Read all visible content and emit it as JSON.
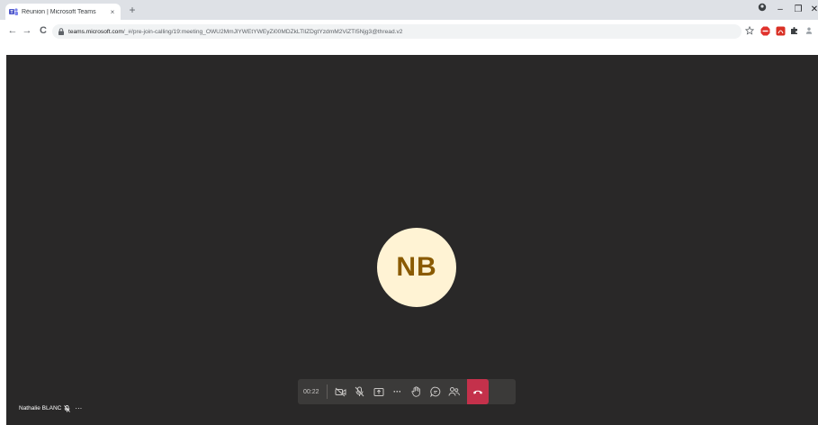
{
  "browser": {
    "tab_title": "Réunion | Microsoft Teams",
    "tab_close": "×",
    "new_tab": "+",
    "url_host": "teams.microsoft.com",
    "url_path": "/_#/pre-join-calling/19:meeting_OWU2MmJlYWEtYWEyZi00MDZkLTllZDgtYzdmM2ViZTI5Njg3@thread.v2",
    "back_glyph": "←",
    "forward_glyph": "→",
    "reload_glyph": "C",
    "minimize_glyph": "–",
    "restore_glyph": "❐",
    "close_glyph": "✕"
  },
  "meeting": {
    "avatar_initials": "NB",
    "timer": "00:22",
    "participant_name": "Nathalie BLANC",
    "participant_more": "···",
    "more_actions": "···",
    "colors": {
      "stage_background": "#292828",
      "control_bar": "#3b3a39",
      "hangup": "#c4314b",
      "avatar_background": "#fff3d4",
      "avatar_text": "#8a5a00"
    },
    "icons": [
      "camera-off-icon",
      "mic-off-icon",
      "share-screen-icon",
      "more-icon",
      "raise-hand-icon",
      "chat-icon",
      "participants-icon",
      "hang-up-icon"
    ]
  }
}
